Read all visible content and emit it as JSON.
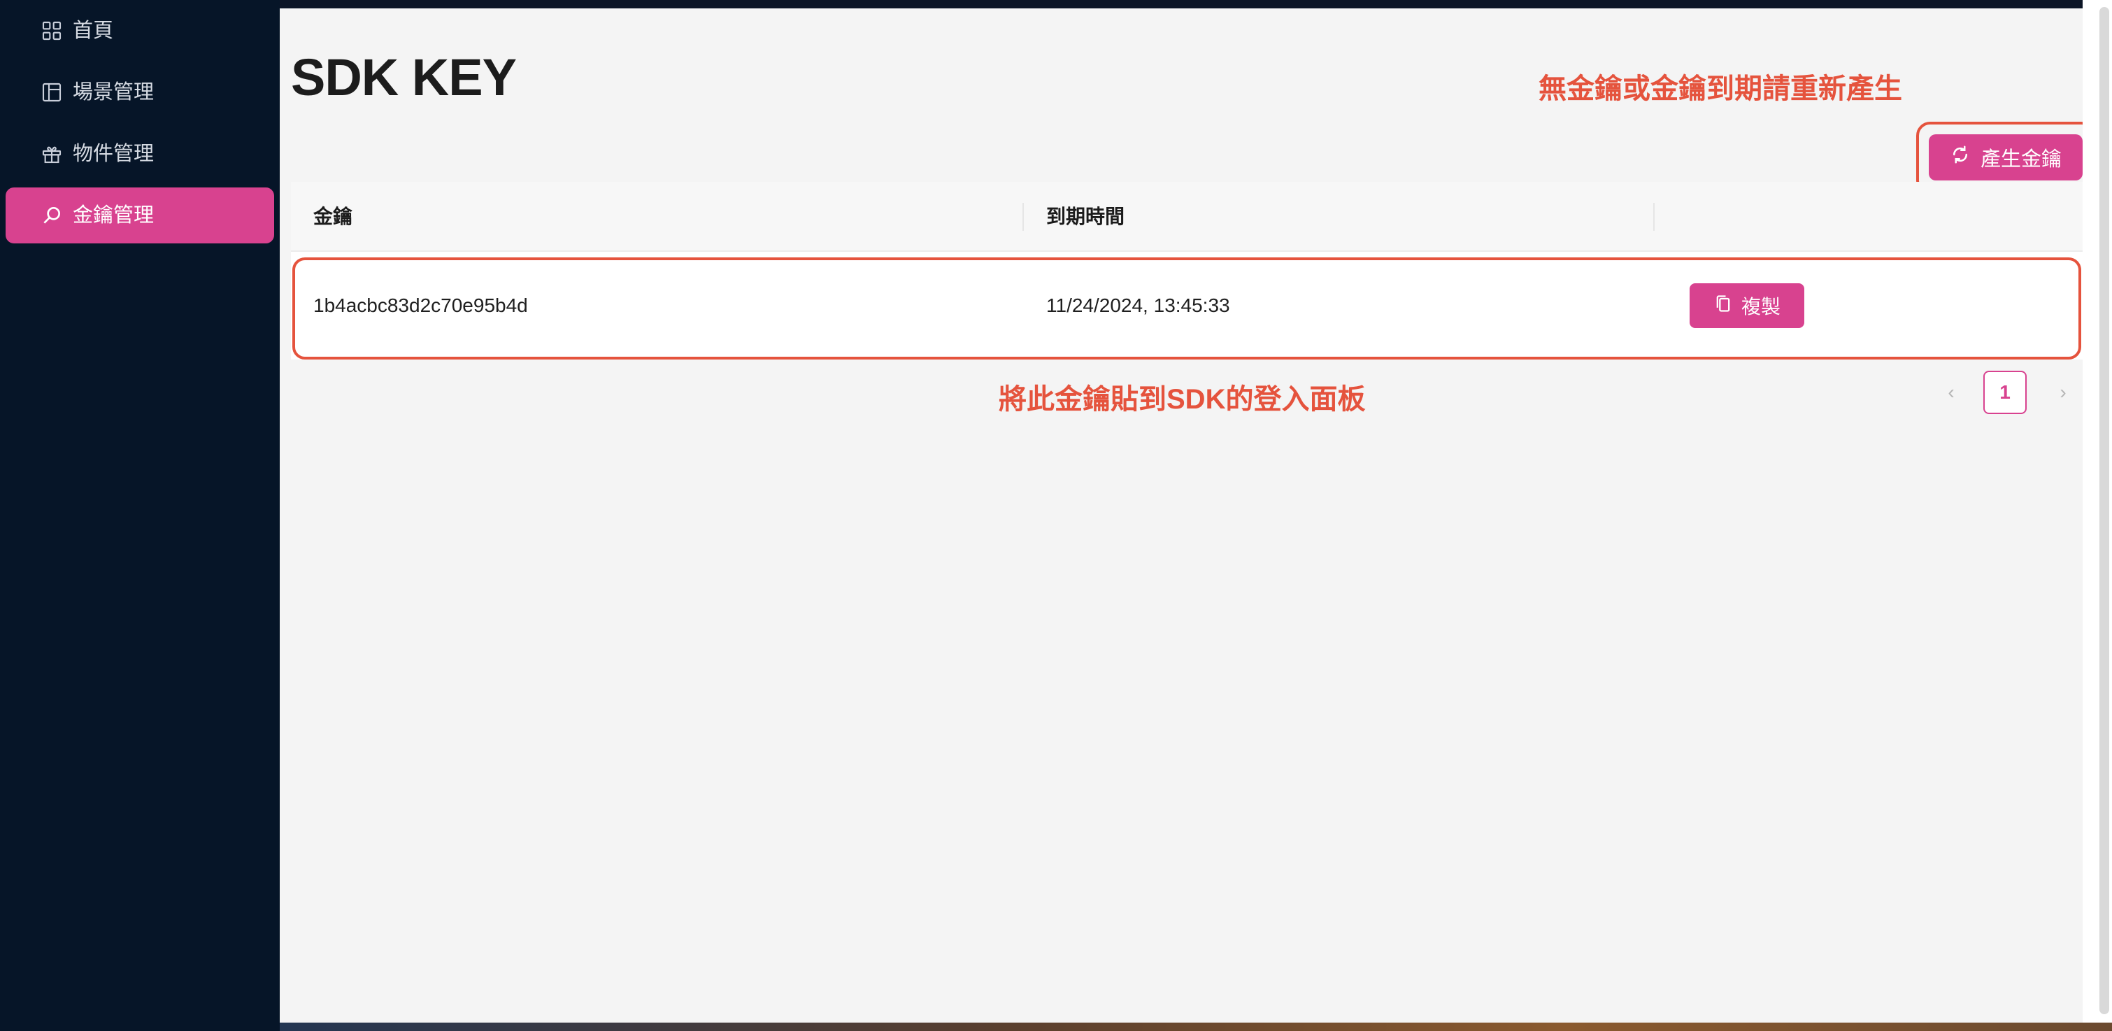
{
  "sidebar": {
    "items": [
      {
        "label": "首頁",
        "icon": "dashboard-icon",
        "active": false
      },
      {
        "label": "場景管理",
        "icon": "layout-icon",
        "active": false
      },
      {
        "label": "物件管理",
        "icon": "gift-icon",
        "active": false
      },
      {
        "label": "金鑰管理",
        "icon": "search-icon",
        "active": true
      }
    ]
  },
  "page": {
    "title": "SDK KEY",
    "generate_button": "產生金鑰"
  },
  "annotations": {
    "top": "無金鑰或金鑰到期請重新產生",
    "middle": "將此金鑰貼到SDK的登入面板"
  },
  "table": {
    "headers": [
      "金鑰",
      "到期時間",
      ""
    ],
    "rows": [
      {
        "key": "1b4acbc83d2c70e95b4d",
        "expires": "11/24/2024, 13:45:33",
        "action": "複製"
      }
    ]
  },
  "pagination": {
    "current_page": "1",
    "prev_icon": "chevron-left-icon",
    "next_icon": "chevron-right-icon"
  },
  "colors": {
    "accent": "#d8428f",
    "annotation": "#e5533d",
    "sidebar_bg": "#061528"
  }
}
